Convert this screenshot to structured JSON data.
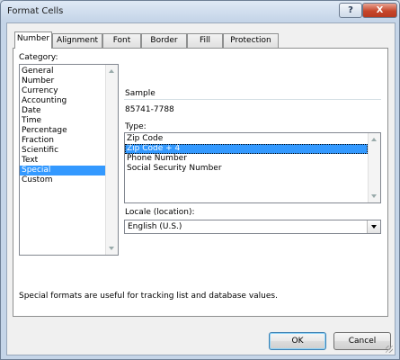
{
  "window": {
    "title": "Format Cells",
    "help_label": "?",
    "close_label": "X"
  },
  "tabs": [
    {
      "label": "Number",
      "active": true
    },
    {
      "label": "Alignment"
    },
    {
      "label": "Font"
    },
    {
      "label": "Border"
    },
    {
      "label": "Fill"
    },
    {
      "label": "Protection"
    }
  ],
  "category": {
    "label": "Category:",
    "items": [
      "General",
      "Number",
      "Currency",
      "Accounting",
      "Date",
      "Time",
      "Percentage",
      "Fraction",
      "Scientific",
      "Text",
      "Special",
      "Custom"
    ],
    "selected": "Special"
  },
  "sample": {
    "label": "Sample",
    "value": "85741-7788"
  },
  "type": {
    "label": "Type:",
    "items": [
      "Zip Code",
      "Zip Code + 4",
      "Phone Number",
      "Social Security Number"
    ],
    "selected": "Zip Code + 4"
  },
  "locale": {
    "label": "Locale (location):",
    "value": "English (U.S.)"
  },
  "description": "Special formats are useful for tracking list and database values.",
  "buttons": {
    "ok": "OK",
    "cancel": "Cancel"
  }
}
